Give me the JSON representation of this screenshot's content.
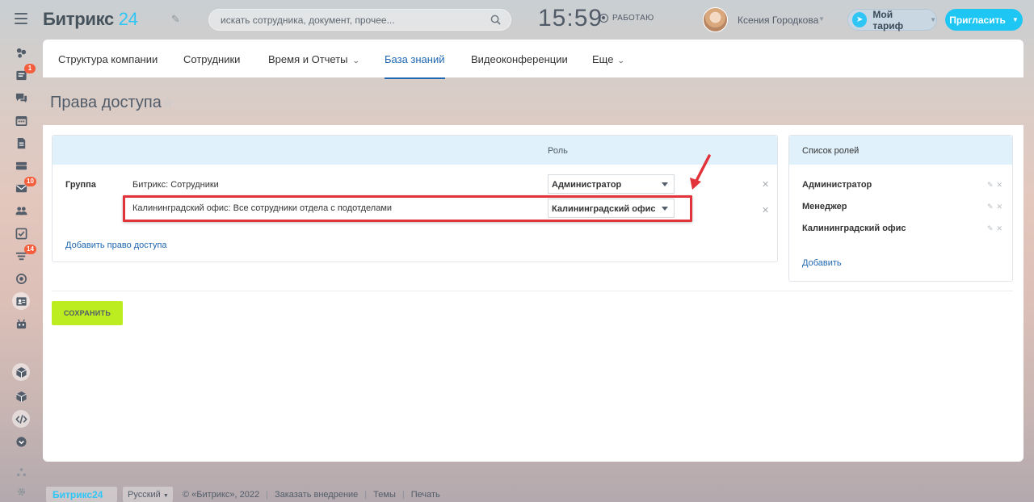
{
  "header": {
    "logo_text": "Битрикс",
    "logo_num": "24",
    "search_placeholder": "искать сотрудника, документ, прочее...",
    "clock": "15:59",
    "work_status": "РАБОТАЮ",
    "user_name": "Ксения Городкова",
    "tariff_label": "Мой тариф",
    "invite_label": "Пригласить"
  },
  "sidebar": {
    "items": [
      {
        "icon": "widget-icon",
        "badge": ""
      },
      {
        "icon": "feed-icon",
        "badge": "1"
      },
      {
        "icon": "chat-icon",
        "badge": ""
      },
      {
        "icon": "calendar-icon",
        "badge": ""
      },
      {
        "icon": "documents-icon",
        "badge": ""
      },
      {
        "icon": "drive-icon",
        "badge": ""
      },
      {
        "icon": "mail-icon",
        "badge": "10"
      },
      {
        "icon": "employees-icon",
        "badge": ""
      },
      {
        "icon": "tasks-icon",
        "badge": ""
      },
      {
        "icon": "crm-icon",
        "badge": "14"
      },
      {
        "icon": "target-icon",
        "badge": ""
      },
      {
        "icon": "contacts-icon",
        "badge": ""
      },
      {
        "icon": "robot-icon",
        "badge": ""
      },
      {
        "icon": "box-icon",
        "badge": ""
      },
      {
        "icon": "cube-icon",
        "badge": ""
      },
      {
        "icon": "code-icon",
        "badge": ""
      },
      {
        "icon": "more-icon",
        "badge": ""
      }
    ]
  },
  "tabs": {
    "structure": "Структура компании",
    "employees": "Сотрудники",
    "time_reports": "Время и Отчеты",
    "knowledge": "База знаний",
    "video": "Видеоконференции",
    "more": "Еще"
  },
  "page": {
    "title": "Права доступа"
  },
  "rights": {
    "role_column": "Роль",
    "group_label": "Группа",
    "rows": [
      {
        "name": "Битрикс: Сотрудники",
        "role": "Администратор"
      },
      {
        "name": "Калининградский офис: Все сотрудники отдела с подотделами",
        "role": "Калининградский офис"
      }
    ],
    "add_link": "Добавить право доступа"
  },
  "roles": {
    "title": "Список ролей",
    "items": [
      "Администратор",
      "Менеджер",
      "Калининградский офис"
    ],
    "add_link": "Добавить"
  },
  "actions": {
    "save": "СОХРАНИТЬ"
  },
  "footer": {
    "logo": "Битрикс24",
    "language": "Русский",
    "copyright": "© «Битрикс», 2022",
    "order": "Заказать внедрение",
    "themes": "Темы",
    "print": "Печать"
  },
  "colors": {
    "accent": "#2fc6f6",
    "link": "#2067b0",
    "save_button": "#bbed21",
    "highlight": "#e2323a",
    "badge": "#f55e3c"
  }
}
